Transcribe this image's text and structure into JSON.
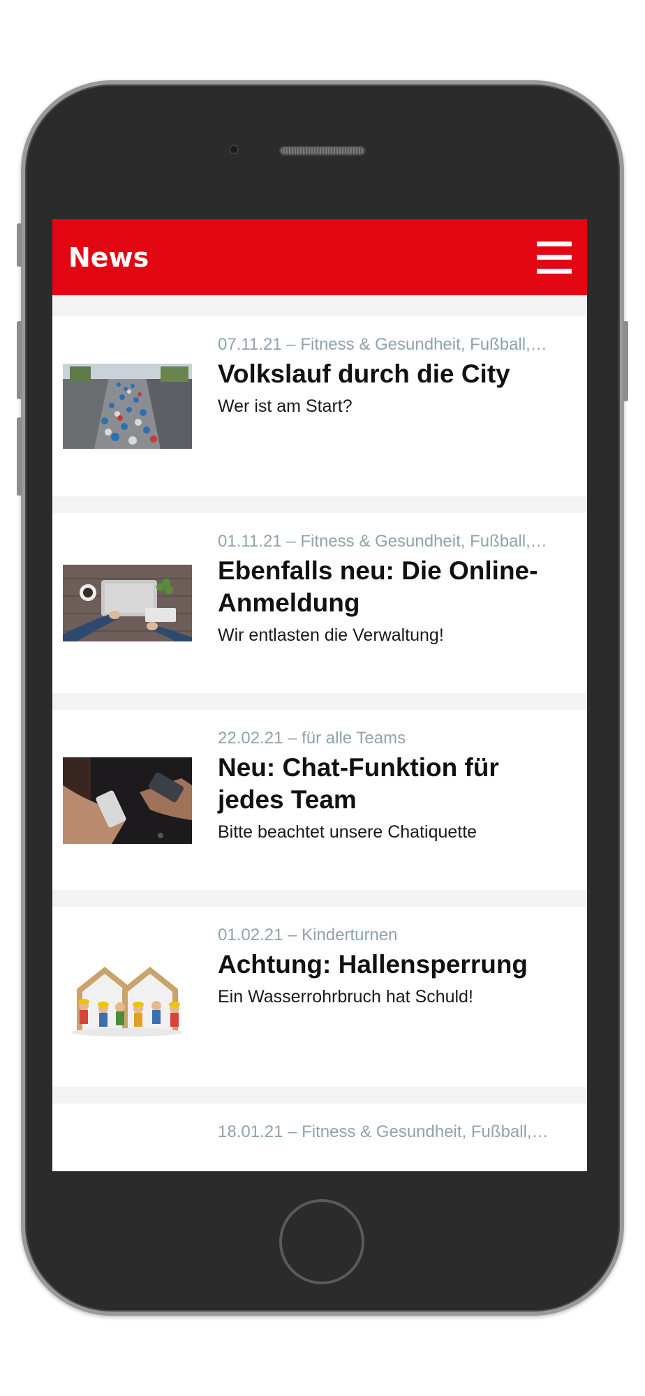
{
  "app": {
    "title": "News",
    "menu_icon": "hamburger-menu-icon"
  },
  "colors": {
    "accent": "#e30613",
    "meta_text": "#8fa3ad",
    "background": "#f3f3f4"
  },
  "news": [
    {
      "meta": "07.11.21 – Fitness & Gesundheit, Fußball,…",
      "title": "Volkslauf durch die City",
      "subtitle": "Wer ist am Start?",
      "image": "marathon-runners-photo"
    },
    {
      "meta": "01.11.21 – Fitness & Gesundheit, Fußball,…",
      "title": "Ebenfalls neu: Die Online-Anmeldung",
      "subtitle": "Wir entlasten die Verwaltung!",
      "image": "laptop-desk-photo"
    },
    {
      "meta": "22.02.21 – für alle Teams",
      "title": "Neu: Chat-Funktion für jedes Team",
      "subtitle": "Bitte beachtet unsere Chatiquette",
      "image": "smartphones-hands-photo"
    },
    {
      "meta": "01.02.21 – Kinderturnen",
      "title": "Achtung: Hallensperrung",
      "subtitle": "Ein Wasserrohrbruch hat Schuld!",
      "image": "worker-figurines-photo"
    },
    {
      "meta": "18.01.21 – Fitness & Gesundheit, Fußball,…",
      "title": "",
      "subtitle": "",
      "image": ""
    }
  ]
}
